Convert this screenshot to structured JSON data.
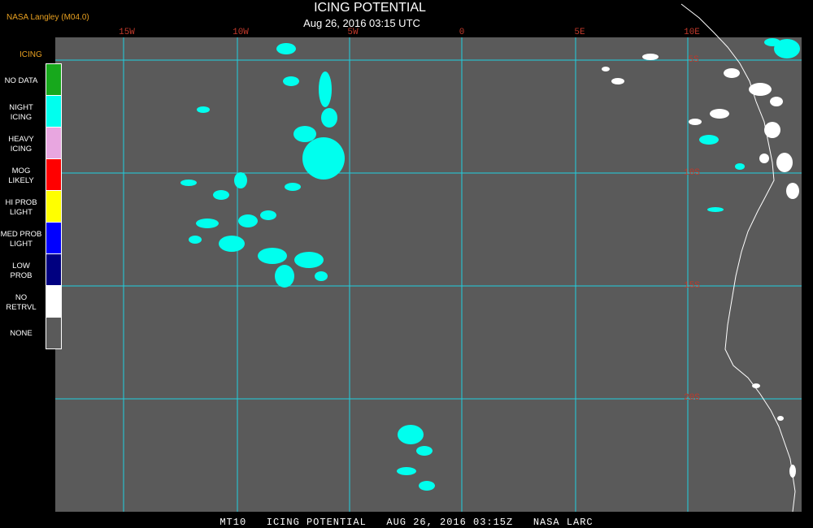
{
  "header": {
    "credit": "NASA Langley (M04.0)",
    "title": "ICING POTENTIAL",
    "subtitle": "Aug 26, 2016 03:15 UTC"
  },
  "longitude_labels": [
    "15W",
    "10W",
    "5W",
    "0",
    "5E",
    "10E"
  ],
  "latitude_labels": [
    "5S",
    "10S",
    "15S",
    "20S"
  ],
  "legend": {
    "title": "ICING",
    "items": [
      {
        "label": "NO DATA",
        "color": "#17a81c"
      },
      {
        "label": "NIGHT\nICING",
        "color": "#00ffee"
      },
      {
        "label": "HEAVY\nICING",
        "color": "#e8a6e0"
      },
      {
        "label": "MOG\nLIKELY",
        "color": "#ff0000"
      },
      {
        "label": "HI PROB\nLIGHT",
        "color": "#ffff00"
      },
      {
        "label": "MED PROB\nLIGHT",
        "color": "#0000ff"
      },
      {
        "label": "LOW\nPROB",
        "color": "#000080"
      },
      {
        "label": "NO\nRETRVL",
        "color": "#ffffff"
      },
      {
        "label": "NONE",
        "color": "#5a5a5a"
      }
    ]
  },
  "footer": "MT10   ICING POTENTIAL   AUG 26, 2016 03:15Z   NASA LARC",
  "colors": {
    "map_background": "#5a5a5a",
    "grid": "#20d0e0",
    "label_red": "#c0392b",
    "icing": "#00ffee",
    "no_retrieval": "#ffffff"
  }
}
